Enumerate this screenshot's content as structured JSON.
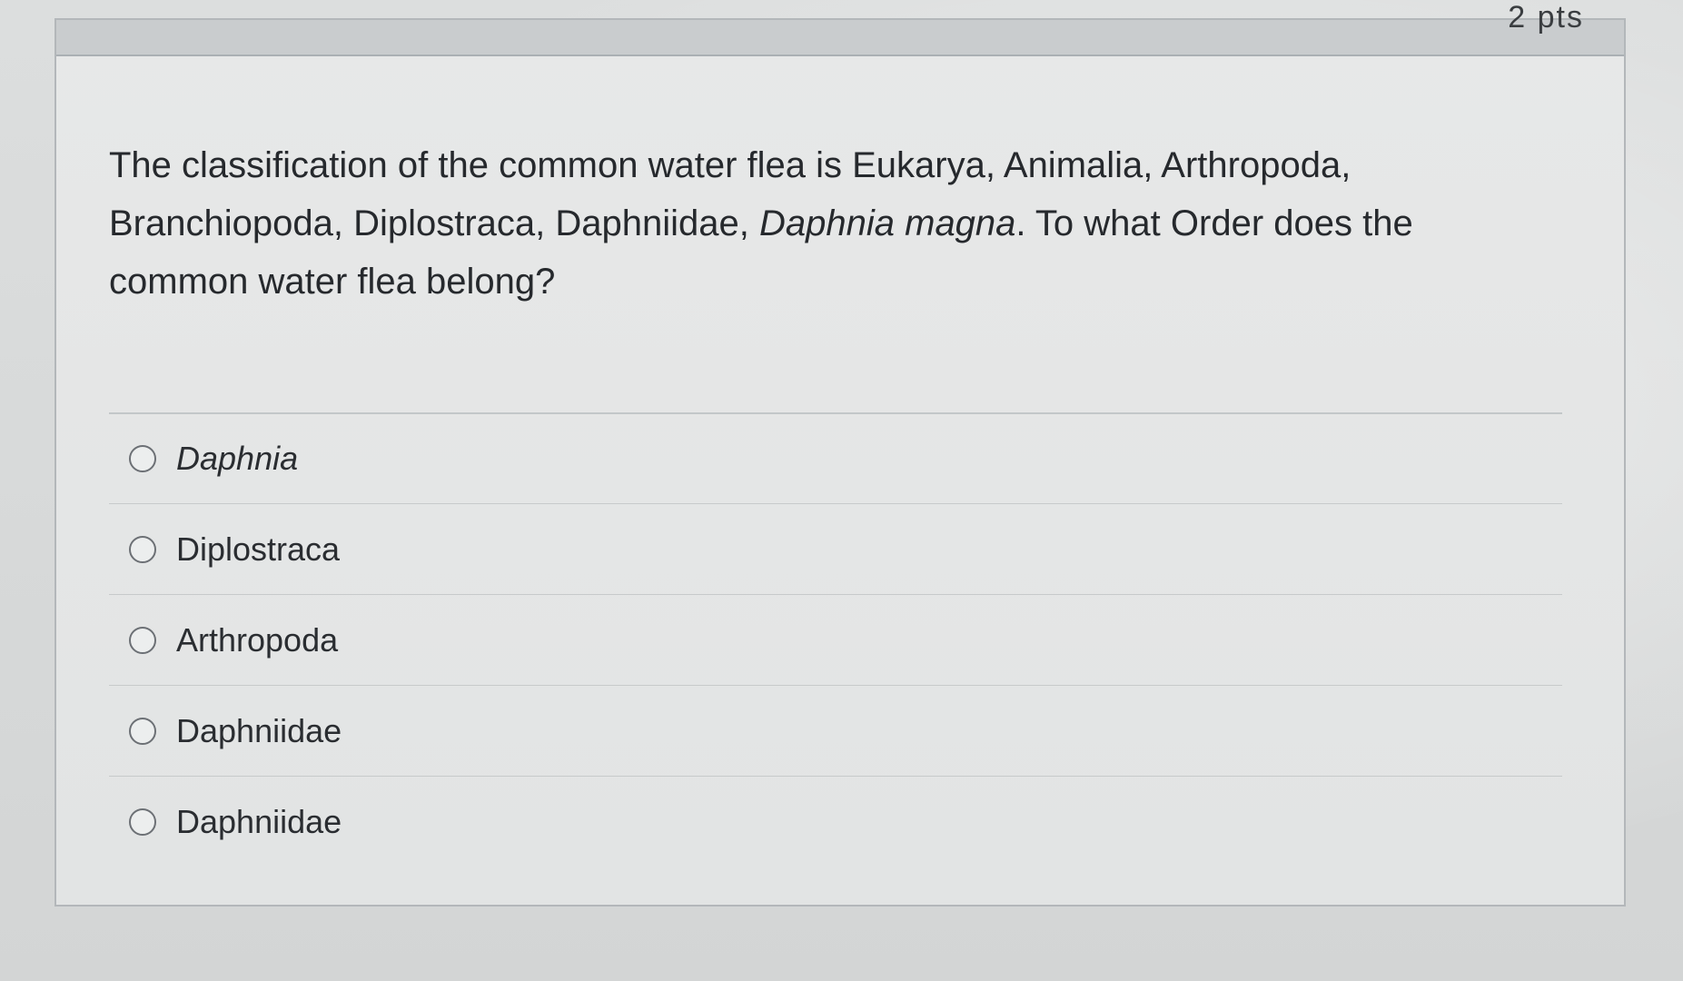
{
  "header": {
    "points": "2 pts"
  },
  "question": {
    "text_before": "The classification of the common water flea is Eukarya, Animalia, Arthropoda, Branchiopoda, Diplostraca, Daphniidae, ",
    "text_italic": "Daphnia magna",
    "text_after": ". To what Order does the common water flea belong?"
  },
  "answers": [
    {
      "label": "Daphnia",
      "italic": true
    },
    {
      "label": "Diplostraca",
      "italic": false
    },
    {
      "label": "Arthropoda",
      "italic": false
    },
    {
      "label": "Daphniidae",
      "italic": false
    },
    {
      "label": "Daphniidae",
      "italic": false
    }
  ]
}
